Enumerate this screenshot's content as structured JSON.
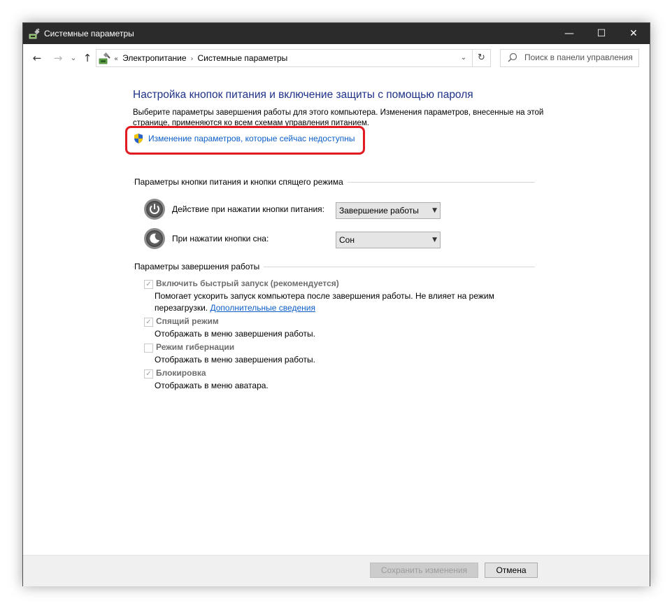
{
  "window": {
    "title": "Системные параметры",
    "controls": {
      "minimize": "—",
      "maximize": "☐",
      "close": "✕"
    }
  },
  "address_bar": {
    "back": "←",
    "forward": "→",
    "recent": "⌄",
    "up": "↑",
    "breadcrumb_prefix": "«",
    "breadcrumbs": [
      "Электропитание",
      "Системные параметры"
    ],
    "separator": "›",
    "dropdown": "⌄",
    "refresh": "↻",
    "search_placeholder": "Поиск в панели управления"
  },
  "main": {
    "heading": "Настройка кнопок питания и включение защиты с помощью пароля",
    "description": "Выберите параметры завершения работы для этого компьютера. Изменения параметров, внесенные на этой странице, применяются ко всем схемам управления питанием.",
    "admin_link": "Изменение параметров, которые сейчас недоступны",
    "highlight_color": "#e21b23",
    "power_group": {
      "title": "Параметры кнопки питания и кнопки спящего режима",
      "rows": [
        {
          "label": "Действие при нажатии кнопки питания:",
          "value": "Завершение работы",
          "icon": "power-button-icon"
        },
        {
          "label": "При нажатии кнопки сна:",
          "value": "Сон",
          "icon": "sleep-button-icon"
        }
      ]
    },
    "shutdown_group": {
      "title": "Параметры завершения работы",
      "options": [
        {
          "label": "Включить быстрый запуск (рекомендуется)",
          "checked": true,
          "desc": "Помогает ускорить запуск компьютера после завершения работы. Не влияет на режим перезагрузки.",
          "link": "Дополнительные сведения"
        },
        {
          "label": "Спящий режим",
          "checked": true,
          "desc": "Отображать в меню завершения работы."
        },
        {
          "label": "Режим гибернации",
          "checked": false,
          "desc": "Отображать в меню завершения работы."
        },
        {
          "label": "Блокировка",
          "checked": true,
          "desc": "Отображать в меню аватара."
        }
      ]
    }
  },
  "footer": {
    "save": "Сохранить изменения",
    "cancel": "Отмена"
  },
  "colors": {
    "heading": "#1e3287",
    "link": "#0b5ec9",
    "titlebar": "#2b2b2b"
  }
}
